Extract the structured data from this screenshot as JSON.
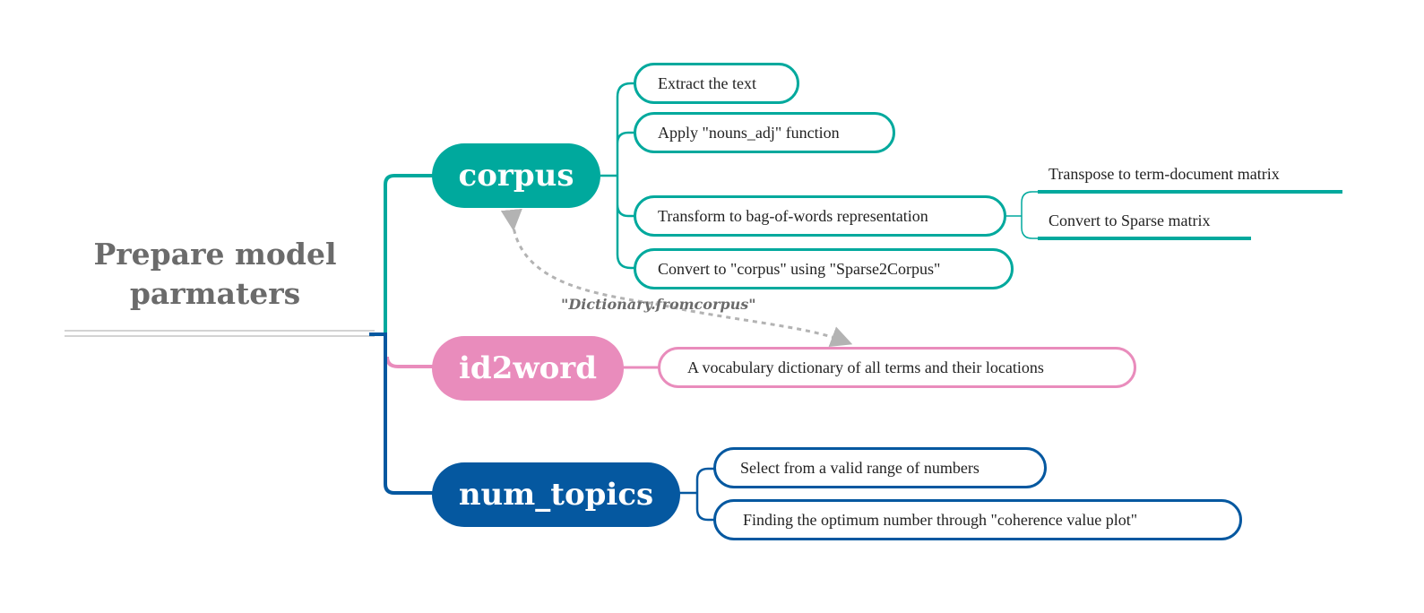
{
  "root": {
    "title_line1": "Prepare model",
    "title_line2": "parmaters"
  },
  "colors": {
    "corpus": "#00a99d",
    "id2word": "#e98cbc",
    "num_topics": "#0558a0",
    "root_text": "#6b6b6b",
    "relation": "#b3b3b3"
  },
  "branches": {
    "corpus": {
      "label": "corpus",
      "children": [
        {
          "label": "Extract the text"
        },
        {
          "label": "Apply \"nouns_adj\" function"
        },
        {
          "label": "Transform to bag-of-words representation",
          "children": [
            {
              "label": "Transpose  to term-document matrix"
            },
            {
              "label": "Convert to Sparse matrix"
            }
          ]
        },
        {
          "label": "Convert to \"corpus\" using \"Sparse2Corpus\""
        }
      ]
    },
    "id2word": {
      "label": "id2word",
      "children": [
        {
          "label": "A vocabulary dictionary of all terms and their locations"
        }
      ]
    },
    "num_topics": {
      "label": "num_topics",
      "children": [
        {
          "label": "Select from a valid range of numbers"
        },
        {
          "label": "Finding the optimum number through \"coherence value plot\""
        }
      ]
    }
  },
  "relation": {
    "label": "\"Dictionary.fromcorpus\""
  }
}
